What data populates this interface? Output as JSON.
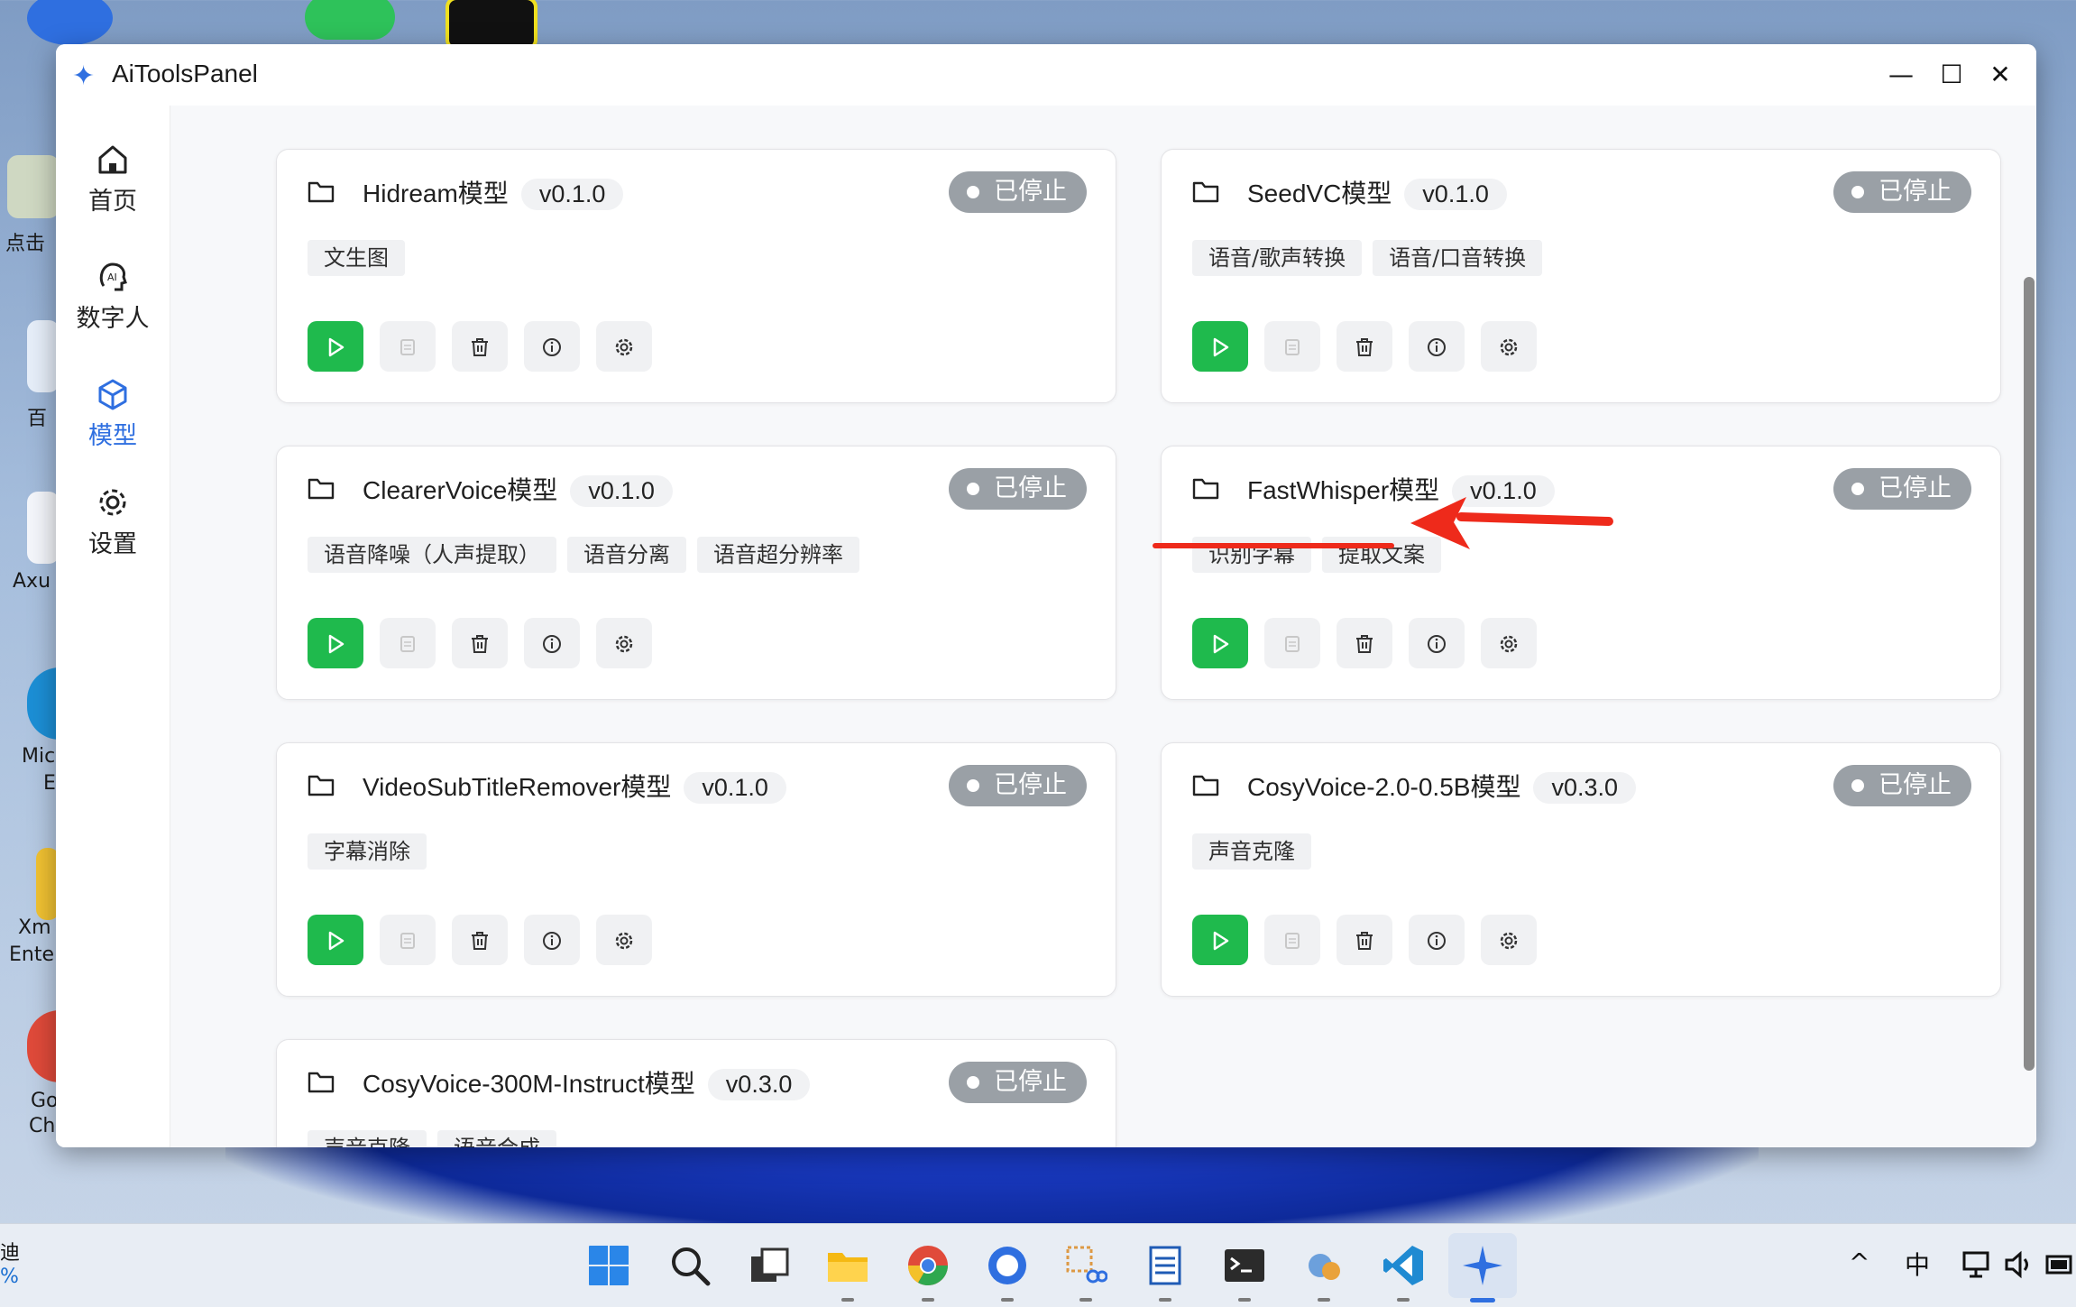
{
  "window": {
    "title": "AiToolsPanel",
    "controls": {
      "minimize": "—",
      "maximize": "☐",
      "close": "✕"
    }
  },
  "sidebar": {
    "items": [
      {
        "label": "首页",
        "icon": "home-icon",
        "active": false
      },
      {
        "label": "数字人",
        "icon": "ai-head-icon",
        "active": false
      },
      {
        "label": "模型",
        "icon": "cube-icon",
        "active": true
      },
      {
        "label": "设置",
        "icon": "gear-icon",
        "active": false
      }
    ]
  },
  "status_label": "已停止",
  "cards": [
    {
      "name": "Hidream模型",
      "version": "v0.1.0",
      "status": "已停止",
      "tags": [
        "文生图"
      ]
    },
    {
      "name": "SeedVC模型",
      "version": "v0.1.0",
      "status": "已停止",
      "tags": [
        "语音/歌声转换",
        "语音/口音转换"
      ]
    },
    {
      "name": "ClearerVoice模型",
      "version": "v0.1.0",
      "status": "已停止",
      "tags": [
        "语音降噪（人声提取）",
        "语音分离",
        "语音超分辨率"
      ]
    },
    {
      "name": "FastWhisper模型",
      "version": "v0.1.0",
      "status": "已停止",
      "tags": [
        "识别字幕",
        "提取文案"
      ]
    },
    {
      "name": "VideoSubTitleRemover模型",
      "version": "v0.1.0",
      "status": "已停止",
      "tags": [
        "字幕消除"
      ]
    },
    {
      "name": "CosyVoice-2.0-0.5B模型",
      "version": "v0.3.0",
      "status": "已停止",
      "tags": [
        "声音克隆"
      ]
    },
    {
      "name": "CosyVoice-300M-Instruct模型",
      "version": "v0.3.0",
      "status": "已停止",
      "tags": [
        "声音克隆",
        "语音合成"
      ]
    }
  ],
  "actions": [
    "play-icon",
    "log-icon",
    "trash-icon",
    "info-icon",
    "gear-icon"
  ],
  "colors": {
    "accent": "#2f6fe0",
    "play": "#1fba4d",
    "status_bg": "#9aa0a6",
    "annotation": "#ee2a1b"
  },
  "desktop": {
    "labels": [
      "点击",
      "百",
      "Axu",
      "Mic",
      "E",
      "Xm",
      "Ente",
      "Go",
      "Ch"
    ]
  },
  "taskbar": {
    "left_text": [
      "迪",
      "%"
    ],
    "tray": {
      "chevron": "^",
      "ime": "中"
    }
  }
}
